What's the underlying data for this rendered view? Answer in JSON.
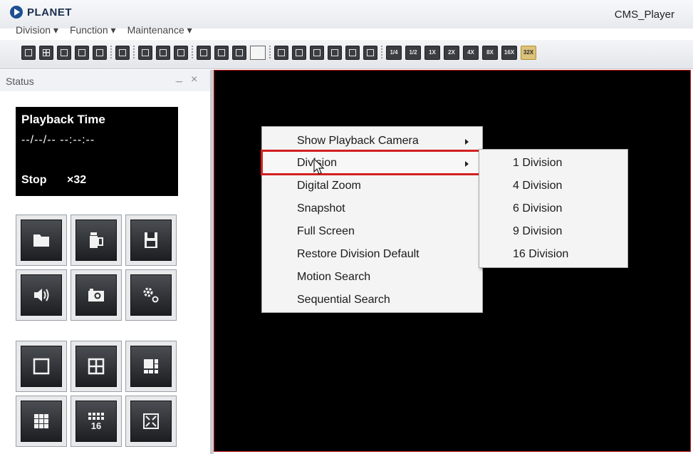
{
  "app": {
    "brand": "PLANET",
    "window_title": "CMS_Player"
  },
  "menu": [
    "Division",
    "Function",
    "Maintenance"
  ],
  "toolbar": {
    "speed_buttons": [
      "1/4",
      "1/2",
      "1X",
      "2X",
      "4X",
      "8X",
      "16X",
      "32X"
    ],
    "active_speed": "32X"
  },
  "status_panel": {
    "title": "Status",
    "pin": "ᅲ",
    "close": "×",
    "playback_time_label": "Playback Time",
    "playback_time_value": "--/--/-- --:--:--",
    "state": "Stop",
    "speed": "×32",
    "buttons_row1": [
      "open-folder-icon",
      "file-icon",
      "save-icon"
    ],
    "buttons_row2": [
      "volume-icon",
      "camera-icon",
      "settings-icon"
    ],
    "buttons_row3": [
      "single-division-icon",
      "four-division-icon",
      "six-division-icon"
    ],
    "buttons_row4": [
      "nine-division-icon",
      "sixteen-division-icon",
      "fullscreen-icon"
    ],
    "sixteen_label": "16"
  },
  "context_menu": {
    "items": [
      "Show Playback Camera",
      "Division",
      "Digital Zoom",
      "Snapshot",
      "Full Screen",
      "Restore Division Default",
      "Motion Search",
      "Sequential Search"
    ],
    "highlighted": "Division",
    "submenu_of": "Division",
    "submenu": [
      "1 Division",
      "4 Division",
      "6 Division",
      "9 Division",
      "16 Division"
    ]
  },
  "colors": {
    "highlight": "#d32020",
    "video_border": "#c01818",
    "active_speed_bg": "#dcc27a"
  }
}
